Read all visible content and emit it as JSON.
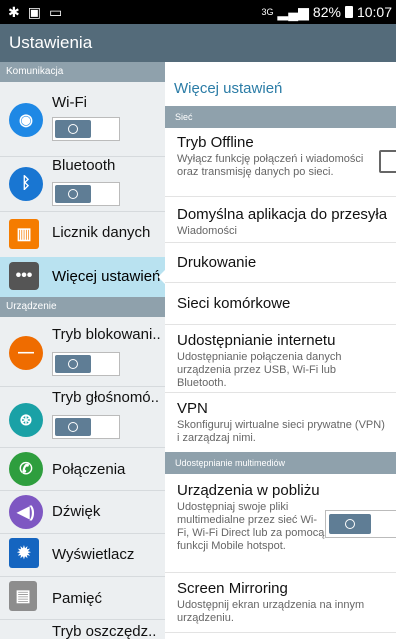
{
  "status": {
    "left_icons": [
      "gear-icon",
      "screenshot-icon",
      "gallery-icon"
    ],
    "network": "3G",
    "battery": "82%",
    "time": "10:07"
  },
  "appbar": {
    "title": "Ustawienia"
  },
  "sidebar": {
    "section_connections": "Komunikacja",
    "wifi": "Wi-Fi",
    "bluetooth": "Bluetooth",
    "data_usage": "Licznik danych",
    "more": "Więcej ustawień",
    "section_device": "Urządzenie",
    "lock": "Tryb blokowani..",
    "volume": "Tryb głośnomó..",
    "calls": "Połączenia",
    "sound": "Dźwięk",
    "display": "Wyświetlacz",
    "storage": "Pamięć",
    "power": "Tryb oszczędz.."
  },
  "main": {
    "title": "Więcej ustawień",
    "section_network": "Sieć",
    "airplane": {
      "title": "Tryb Offline",
      "subtitle": "Wyłącz funkcję połączeń i wiadomości oraz transmisję danych po sieci."
    },
    "default_msg": {
      "title": "Domyślna aplikacja do przesyła..",
      "subtitle": "Wiadomości"
    },
    "printing": {
      "title": "Drukowanie"
    },
    "mobile": {
      "title": "Sieci komórkowe"
    },
    "tethering": {
      "title": "Udostępnianie internetu",
      "subtitle": "Udostępnianie połączenia danych urządzenia przez USB, Wi-Fi lub Bluetooth."
    },
    "vpn": {
      "title": "VPN",
      "subtitle": "Skonfiguruj wirtualne sieci prywatne (VPN) i zarządzaj nimi."
    },
    "section_media": "Udostępnianie multimediów",
    "nearby": {
      "title": "Urządzenia w pobliżu",
      "subtitle": "Udostępniaj swoje pliki multimedialne przez sieć Wi-Fi, Wi-Fi Direct lub za pomocą funkcji Mobile hotspot."
    },
    "mirroring": {
      "title": "Screen Mirroring",
      "subtitle": "Udostępnij ekran urządzenia na innym urządzeniu."
    }
  }
}
